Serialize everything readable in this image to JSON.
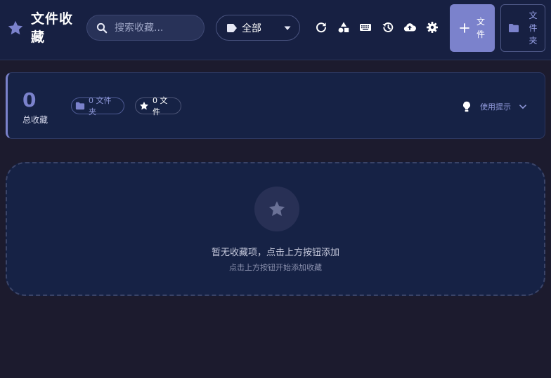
{
  "brand": {
    "title": "文件收藏"
  },
  "search": {
    "placeholder": "搜索收藏..."
  },
  "filter": {
    "selected": "全部"
  },
  "toolbar": {
    "icons": [
      "refresh-icon",
      "shapes-icon",
      "keyboard-icon",
      "history-icon",
      "cloud-upload-icon",
      "gear-icon"
    ]
  },
  "actions": {
    "add_file_label": "文件",
    "add_folder_label": "文件夹"
  },
  "stats": {
    "total_count": "0",
    "total_label": "总收藏",
    "folder_chip": "0 文件夹",
    "file_chip": "0 文件",
    "tips_label": "使用提示"
  },
  "empty": {
    "message": "暂无收藏项，点击上方按钮添加",
    "sub": "点击上方按钮开始添加收藏"
  },
  "colors": {
    "background": "#1c1b2e",
    "header": "#172042",
    "accent": "#7b82cc",
    "card": "#162245"
  }
}
